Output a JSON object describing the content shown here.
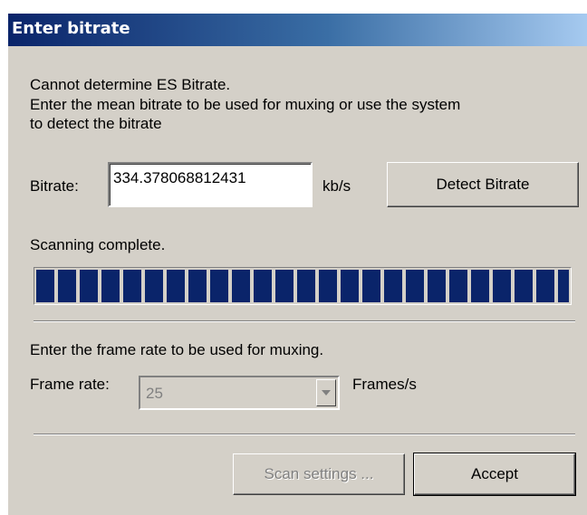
{
  "window": {
    "title": "Enter bitrate"
  },
  "intro": {
    "line1": "Cannot determine ES Bitrate.",
    "line2": "Enter the mean bitrate to be used for muxing or use the system",
    "line3": "to detect the bitrate"
  },
  "bitrate": {
    "label": "Bitrate:",
    "value": "334.378068812431",
    "unit": "kb/s",
    "detect_button": "Detect Bitrate"
  },
  "scan": {
    "status": "Scanning complete.",
    "progress_percent": 100
  },
  "framerate": {
    "instruction": "Enter the frame rate to be used for muxing.",
    "label": "Frame rate:",
    "value": "25",
    "unit": "Frames/s",
    "enabled": false
  },
  "buttons": {
    "scan_settings": "Scan settings ...",
    "scan_settings_enabled": false,
    "accept": "Accept"
  },
  "colors": {
    "title_gradient_start": "#0a246a",
    "title_gradient_end": "#a6caf0",
    "progress_fill": "#0a246a",
    "dialog_face": "#d4d0c8"
  },
  "icons": {
    "combo_dropdown": "chevron-down-icon"
  }
}
